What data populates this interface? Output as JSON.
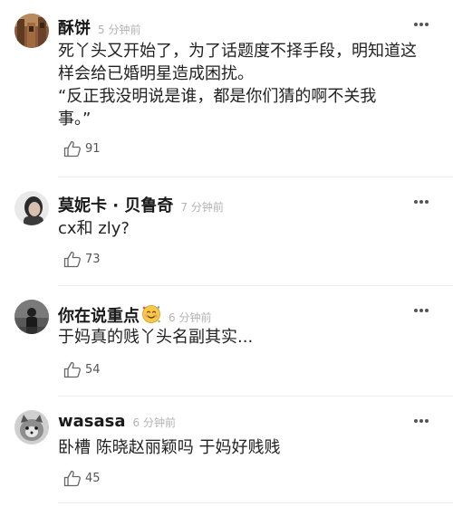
{
  "comments": [
    {
      "username": "酥饼",
      "time": "5 分钟前",
      "lines": [
        "死丫头又开始了，为了话题度不择手段，明知道这",
        "样会给已婚明星造成困扰。",
        "“反正我没明说是谁，都是你们猜的啊不关我",
        "事。”"
      ],
      "likes": "91"
    },
    {
      "username": "莫妮卡 · 贝鲁奇",
      "time": "7 分钟前",
      "lines": [
        "cx和 zly?"
      ],
      "likes": "73"
    },
    {
      "username": "你在说重点",
      "badge_icon": "smiling-face-emoji-icon",
      "time": "6 分钟前",
      "lines": [
        "于妈真的贱丫头名副其实..."
      ],
      "likes": "54"
    },
    {
      "username": "wasasa",
      "time": "6 分钟前",
      "lines": [
        "卧槽 陈晓赵丽颖吗 于妈好贱贱"
      ],
      "likes": "45"
    }
  ],
  "icons": {
    "more": "more-dots-icon",
    "like": "thumbs-up-icon"
  }
}
